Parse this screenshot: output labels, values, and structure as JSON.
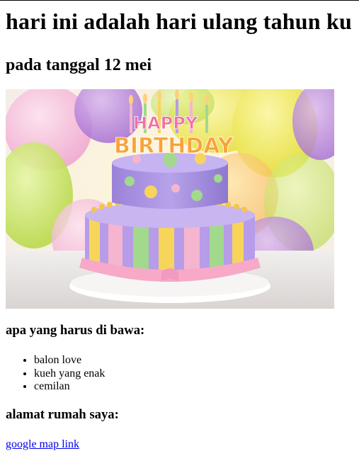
{
  "heading": "hari ini adalah hari ulang tahun ku",
  "subheading": "pada tanggal 12 mei",
  "cake_image": {
    "icon": "birthday-cake-image",
    "topper_text": [
      "HAPPY",
      "BIRTHDAY"
    ],
    "colors": {
      "purple": "#a98ee0",
      "pink": "#f6b6cf",
      "yellow": "#f2d35a",
      "green": "#9fd58b"
    }
  },
  "bring_title": "apa yang harus di bawa:",
  "bring_items": [
    "balon love",
    "kueh yang enak",
    "cemilan"
  ],
  "address_title": "alamat rumah saya:",
  "map_link": "google map link"
}
